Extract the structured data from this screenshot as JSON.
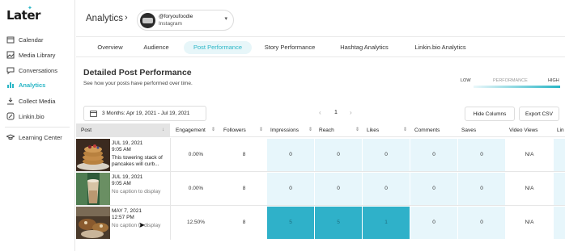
{
  "brand": {
    "logo": "Later",
    "accent": "#29b6c6"
  },
  "sidebar": {
    "items": [
      {
        "label": "Calendar",
        "icon": "calendar-icon",
        "active": false
      },
      {
        "label": "Media Library",
        "icon": "media-library-icon",
        "active": false
      },
      {
        "label": "Conversations",
        "icon": "chat-bubble-icon",
        "active": false
      },
      {
        "label": "Analytics",
        "icon": "bar-chart-icon",
        "active": true
      },
      {
        "label": "Collect Media",
        "icon": "download-icon",
        "active": false
      },
      {
        "label": "Linkin.bio",
        "icon": "link-icon",
        "active": false
      },
      {
        "label": "Learning Center",
        "icon": "graduation-cap-icon",
        "active": false
      }
    ]
  },
  "header": {
    "title": "Analytics",
    "account": {
      "handle": "@foryoufoodie",
      "platform": "Instagram"
    }
  },
  "tabs": [
    {
      "label": "Overview",
      "active": false
    },
    {
      "label": "Audience",
      "active": false
    },
    {
      "label": "Post Performance",
      "active": true
    },
    {
      "label": "Story Performance",
      "active": false
    },
    {
      "label": "Hashtag Analytics",
      "active": false
    },
    {
      "label": "Linkin.bio Analytics",
      "active": false
    }
  ],
  "section": {
    "title": "Detailed Post Performance",
    "subtitle": "See how your posts have performed over time.",
    "legend": {
      "low": "LOW",
      "mid": "PERFORMANCE",
      "high": "HIGH"
    }
  },
  "toolbar": {
    "date_range": "3 Months: Apr 19, 2021 - Jul 19, 2021",
    "page": "1",
    "hide_columns_label": "Hide Columns",
    "export_csv_label": "Export CSV"
  },
  "table": {
    "columns": [
      "Post",
      "Engagement",
      "Followers",
      "Impressions",
      "Reach",
      "Likes",
      "Comments",
      "Saves",
      "Video Views",
      "Lin"
    ],
    "rows": [
      {
        "date": "JUL 19, 2021",
        "time": "9:05 AM",
        "caption": "This towering stack of pancakes will curb...",
        "caption_muted": false,
        "values": [
          "0.00%",
          "8",
          "0",
          "0",
          "0",
          "0",
          "0",
          "N/A"
        ],
        "top": [
          false,
          false,
          false,
          false,
          false,
          false,
          false,
          false
        ]
      },
      {
        "date": "JUL 19, 2021",
        "time": "9:05 AM",
        "caption": "No caption to display",
        "caption_muted": true,
        "values": [
          "0.00%",
          "8",
          "0",
          "0",
          "0",
          "0",
          "0",
          "N/A"
        ],
        "top": [
          false,
          false,
          false,
          false,
          false,
          false,
          false,
          false
        ]
      },
      {
        "date": "MAY 7, 2021",
        "time": "12:57 PM",
        "caption": "No caption to display",
        "caption_muted": true,
        "values": [
          "12.50%",
          "8",
          "5",
          "5",
          "1",
          "0",
          "0",
          "N/A"
        ],
        "top": [
          false,
          false,
          true,
          true,
          true,
          false,
          false,
          false
        ]
      }
    ]
  }
}
